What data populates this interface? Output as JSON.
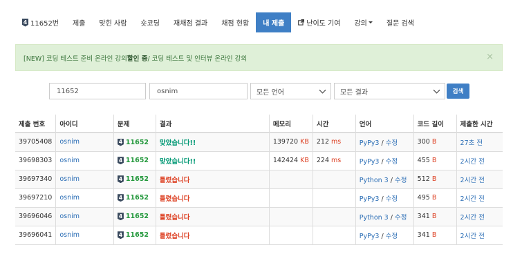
{
  "nav": {
    "problem_number": "11652번",
    "tier_badge": "4",
    "items": [
      "제출",
      "맞힌 사람",
      "숏코딩",
      "재채점 결과",
      "채점 현황",
      "내 제출",
      "난이도 기여",
      "강의",
      "질문 검색"
    ]
  },
  "alert": {
    "prefix": "[NEW] 코딩 테스트 준비 온라인 강의 ",
    "bold": "할인 중",
    "suffix": " / 코딩 테스트 및 인터뷰 온라인 강의",
    "close": "×"
  },
  "filters": {
    "problem_id": "11652",
    "user_id": "osnim",
    "language": "모든 언어",
    "result": "모든 결과",
    "search_label": "검색"
  },
  "table": {
    "headers": [
      "제출 번호",
      "아이디",
      "문제",
      "결과",
      "메모리",
      "시간",
      "언어",
      "코드 길이",
      "제출한 시간"
    ],
    "rows": [
      {
        "id": "39705408",
        "user": "osnim",
        "problem": "11652",
        "result": "맞았습니다!!",
        "memory": "139720",
        "memory_unit": "KB",
        "time": "212",
        "time_unit": "ms",
        "lang": "PyPy3",
        "edit": "수정",
        "length": "300",
        "length_unit": "B",
        "submitted": "27초 전"
      },
      {
        "id": "39698303",
        "user": "osnim",
        "problem": "11652",
        "result": "맞았습니다!!",
        "memory": "142424",
        "memory_unit": "KB",
        "time": "224",
        "time_unit": "ms",
        "lang": "PyPy3",
        "edit": "수정",
        "length": "455",
        "length_unit": "B",
        "submitted": "2시간 전"
      },
      {
        "id": "39697340",
        "user": "osnim",
        "problem": "11652",
        "result": "틀렸습니다",
        "memory": "",
        "memory_unit": "",
        "time": "",
        "time_unit": "",
        "lang": "Python 3",
        "edit": "수정",
        "length": "512",
        "length_unit": "B",
        "submitted": "2시간 전"
      },
      {
        "id": "39697210",
        "user": "osnim",
        "problem": "11652",
        "result": "틀렸습니다",
        "memory": "",
        "memory_unit": "",
        "time": "",
        "time_unit": "",
        "lang": "PyPy3",
        "edit": "수정",
        "length": "495",
        "length_unit": "B",
        "submitted": "2시간 전"
      },
      {
        "id": "39696046",
        "user": "osnim",
        "problem": "11652",
        "result": "틀렸습니다",
        "memory": "",
        "memory_unit": "",
        "time": "",
        "time_unit": "",
        "lang": "Python 3",
        "edit": "수정",
        "length": "341",
        "length_unit": "B",
        "submitted": "2시간 전"
      },
      {
        "id": "39696041",
        "user": "osnim",
        "problem": "11652",
        "result": "틀렸습니다",
        "memory": "",
        "memory_unit": "",
        "time": "",
        "time_unit": "",
        "lang": "PyPy3",
        "edit": "수정",
        "length": "341",
        "length_unit": "B",
        "submitted": "2시간 전"
      }
    ]
  },
  "colors": {
    "accent": "#3f7fc5",
    "accepted": "#009874",
    "wrong": "#dd4124",
    "problem_link": "#21973a",
    "alert_bg": "#dff0d8"
  }
}
